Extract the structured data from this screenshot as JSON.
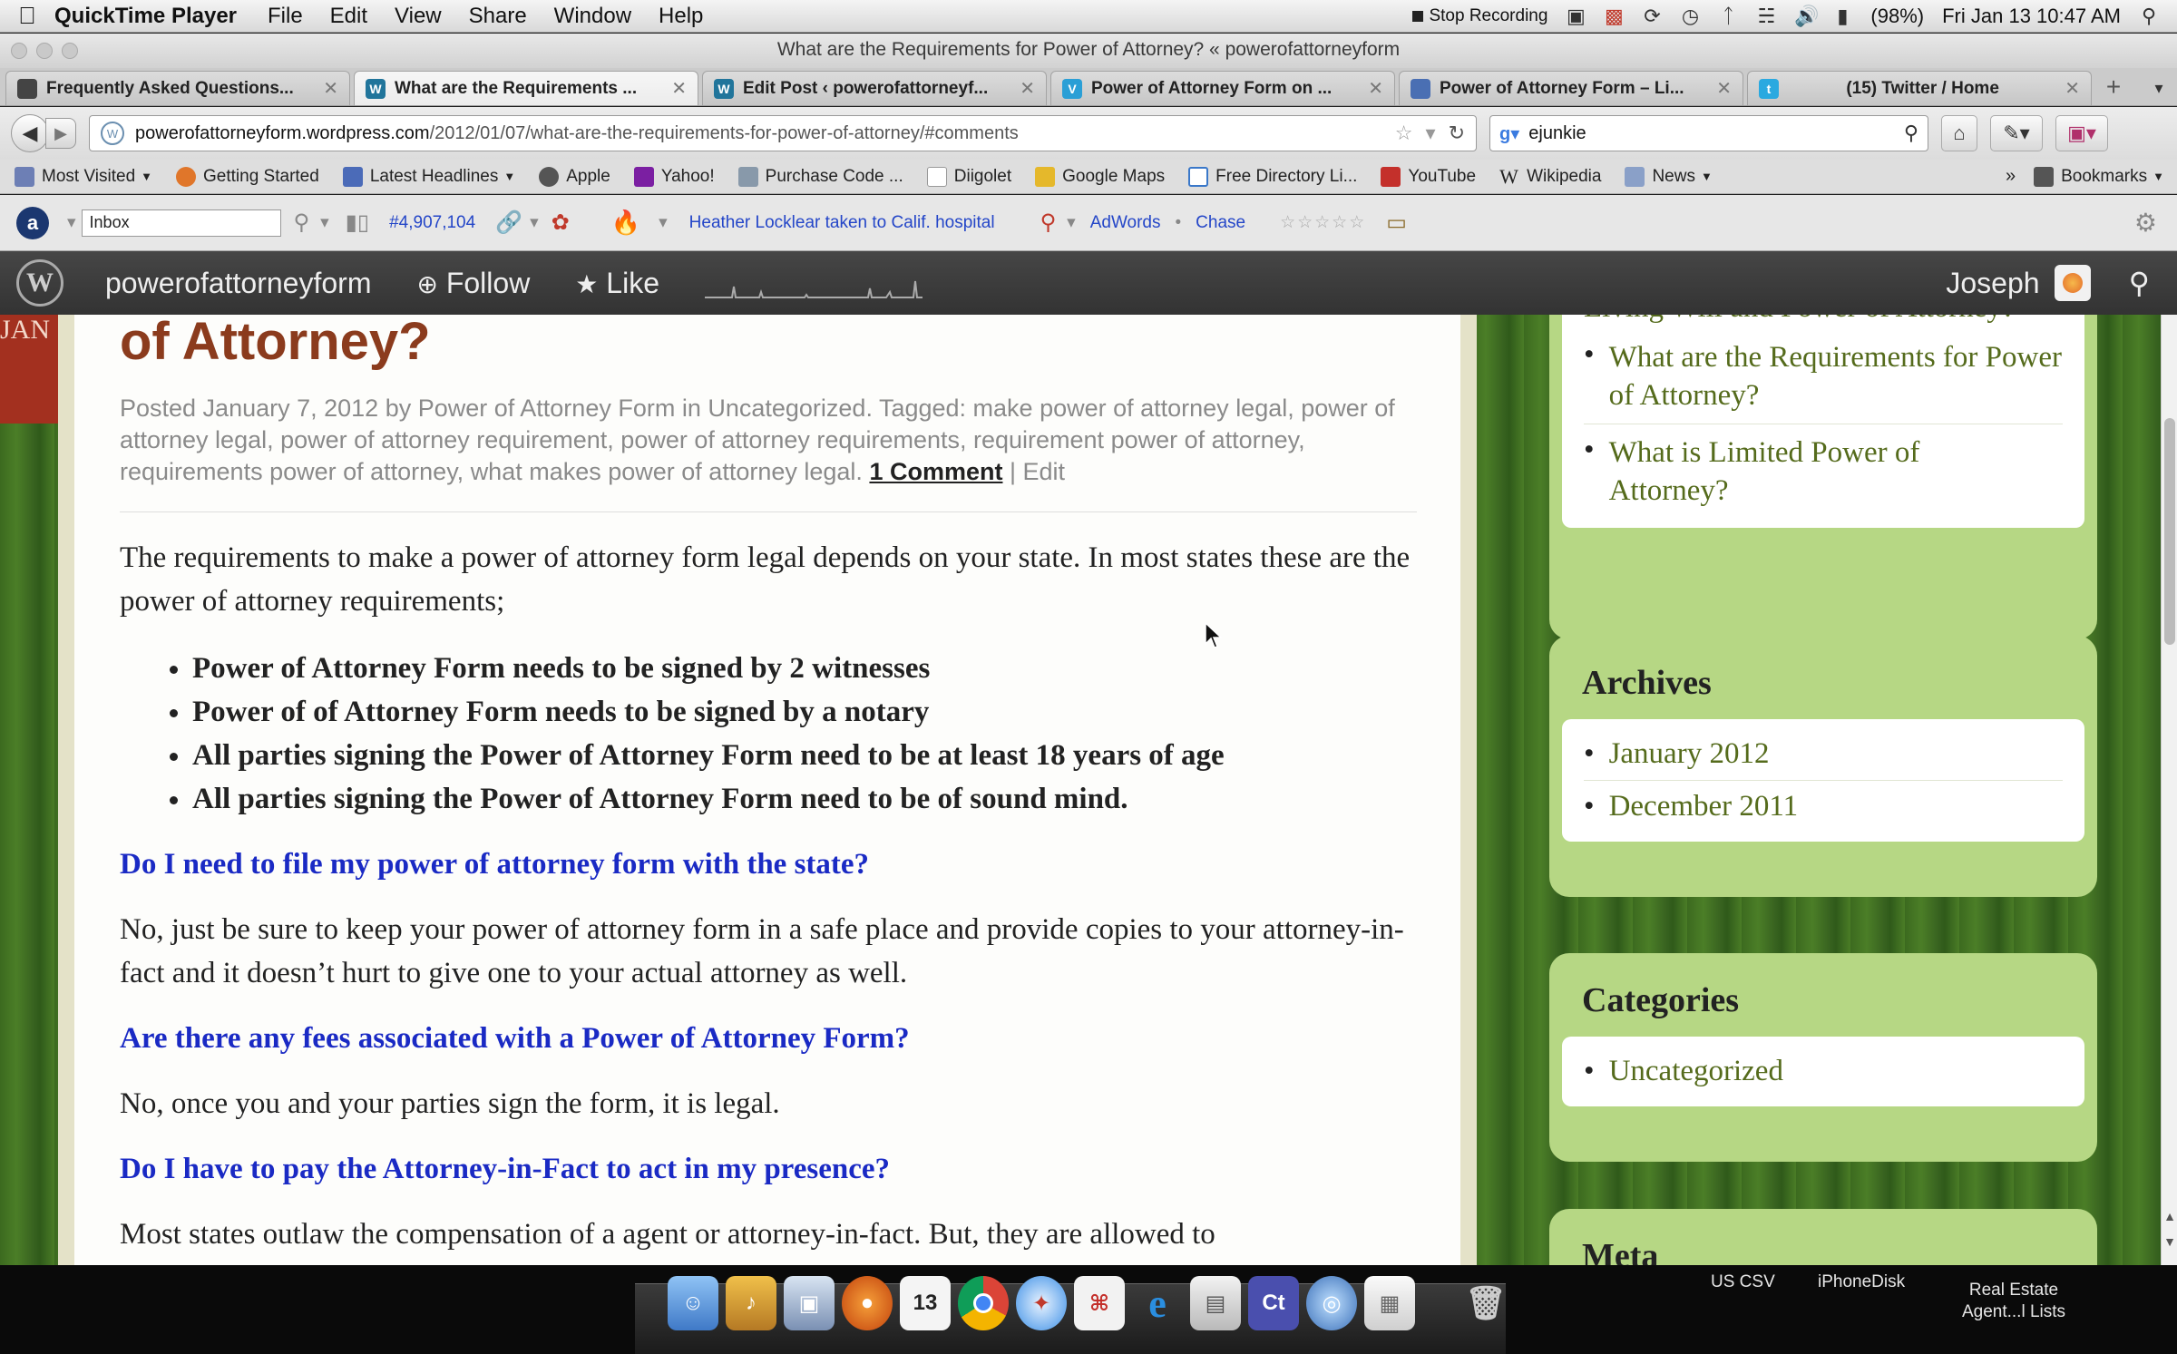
{
  "menubar": {
    "app": "QuickTime Player",
    "items": [
      "File",
      "Edit",
      "View",
      "Share",
      "Window",
      "Help"
    ],
    "stop_recording": "Stop Recording",
    "battery": "(98%)",
    "clock": "Fri Jan 13  10:47 AM"
  },
  "window": {
    "title": "What are the Requirements for Power of Attorney? « powerofattorneyform"
  },
  "tabs": [
    {
      "label": "Frequently Asked Questions...",
      "icon": "page-icon",
      "color": "#444444",
      "active": false
    },
    {
      "label": "What are the Requirements ...",
      "icon": "wordpress-icon",
      "color": "#21759b",
      "active": true
    },
    {
      "label": "Edit Post ‹ powerofattorneyf...",
      "icon": "wordpress-icon",
      "color": "#21759b",
      "active": false
    },
    {
      "label": "Power of Attorney Form on ...",
      "icon": "v-icon",
      "color": "#2a9fd6",
      "active": false
    },
    {
      "label": "Power of Attorney Form – Li...",
      "icon": "site-icon",
      "color": "#4a6fb3",
      "active": false
    },
    {
      "label": "(15) Twitter / Home",
      "icon": "twitter-icon",
      "color": "#2aa9e0",
      "active": false
    }
  ],
  "nav": {
    "url_host": "powerofattorneyform.wordpress.com",
    "url_path": "/2012/01/07/what-are-the-requirements-for-power-of-attorney/#comments",
    "search_value": "ejunkie"
  },
  "bookmarks": [
    {
      "label": "Most Visited",
      "dropdown": true,
      "color": "#6d7fb5"
    },
    {
      "label": "Getting Started",
      "dropdown": false,
      "color": "#e0762a"
    },
    {
      "label": "Latest Headlines",
      "dropdown": true,
      "color": "#4b6bb8"
    },
    {
      "label": "Apple",
      "dropdown": false,
      "color": "#555555"
    },
    {
      "label": "Yahoo!",
      "dropdown": false,
      "color": "#7b1fa2"
    },
    {
      "label": "Purchase Code ...",
      "dropdown": false,
      "color": "#8899aa"
    },
    {
      "label": "Diigolet",
      "dropdown": false,
      "color": "#cccccc"
    },
    {
      "label": "Google Maps",
      "dropdown": false,
      "color": "#e5b82b"
    },
    {
      "label": "Free Directory Li...",
      "dropdown": false,
      "color": "#3a78c9"
    },
    {
      "label": "YouTube",
      "dropdown": false,
      "color": "#c4302b"
    },
    {
      "label": "Wikipedia",
      "dropdown": false,
      "color": "#222222"
    },
    {
      "label": "News",
      "dropdown": true,
      "color": "#8aa0c8"
    }
  ],
  "bookmarks_more": "»",
  "bookmarks_menu": "Bookmarks",
  "addon": {
    "inbox_value": "Inbox",
    "rank": "#4,907,104",
    "headline": "Heather Locklear taken to Calif. hospital",
    "adwords": "AdWords",
    "chase": "Chase"
  },
  "wpbar": {
    "site": "powerofattorneyform",
    "follow": "Follow",
    "like": "Like",
    "user": "Joseph"
  },
  "post": {
    "ribbon": "JAN",
    "title": "of Attorney?",
    "meta_prefix": "Posted January 7, 2012 by Power of Attorney Form in Uncategorized. Tagged: make power of attorney legal, power of attorney legal, power of attorney requirement, power of attorney requirements, requirement power of attorney, requirements power of attorney, what makes power of attorney legal.",
    "comments": "1 Comment",
    "edit": "Edit",
    "intro": "The requirements to make a power of attorney form legal depends on your state. In most states these are the power of attorney requirements;",
    "bullets": [
      "Power of Attorney Form needs to be signed by 2 witnesses",
      "Power of of Attorney Form needs to be signed by a notary",
      "All parties signing the Power of Attorney Form need to be at least 18 years of age",
      "All parties signing the Power of Attorney Form need to be of sound mind."
    ],
    "q1": "Do I need to file my power of attorney form with the state?",
    "a1": "No, just be sure to keep your power of attorney form in a safe place and provide copies to your attorney-in-fact and it doesn’t hurt to give one to your actual attorney as well.",
    "q2": "Are there any fees associated with a Power of Attorney Form?",
    "a2": "No, once you and your parties sign the form, it is legal.",
    "q3": "Do I have to pay the Attorney-in-Fact to act in my presence?",
    "a3": "Most states outlaw the compensation of a agent or attorney-in-fact. But, they are allowed to"
  },
  "sidebar": {
    "recent_partial": "Living Will and Power of Attorney?",
    "recent": [
      "What are the Requirements for Power of Attorney?",
      "What is Limited Power of Attorney?"
    ],
    "archives_title": "Archives",
    "archives": [
      "January 2012",
      "December 2011"
    ],
    "categories_title": "Categories",
    "categories": [
      "Uncategorized"
    ],
    "meta_title": "Meta"
  },
  "dock": {
    "labels": [
      "US CSV",
      "iPhoneDisk",
      "Real Estate Agent...l Lists"
    ],
    "calendar_day": "13",
    "ct_label": "Ct"
  }
}
